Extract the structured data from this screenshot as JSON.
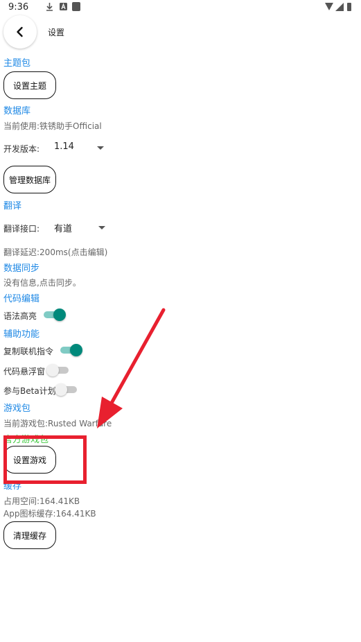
{
  "status_bar": {
    "time": "9:36",
    "icons": [
      "download-icon",
      "a-badge-icon",
      "notification-square-icon",
      "wifi-icon",
      "signal-icon",
      "battery-icon"
    ]
  },
  "header": {
    "back_icon": "chevron-left-icon",
    "title": "设置"
  },
  "theme": {
    "section": "主题包",
    "set_theme_button": "设置主题"
  },
  "database": {
    "section": "数据库",
    "current": "当前使用:铁锈助手Official",
    "dev_version_label": "开发版本:",
    "dev_version_value": "1.14",
    "manage_button": "管理数据库"
  },
  "translation": {
    "section": "翻译",
    "api_label": "翻译接口:",
    "api_value": "有道",
    "delay": "翻译延迟:200ms(点击编辑)"
  },
  "sync": {
    "section": "数据同步",
    "info": "没有信息,点击同步。"
  },
  "code_edit": {
    "section": "代码编辑",
    "syntax_highlight": {
      "label": "语法高亮",
      "on": true
    }
  },
  "assist": {
    "section": "辅助功能",
    "copy_online_cmd": {
      "label": "复制联机指令",
      "on": true
    },
    "code_float_window": {
      "label": "代码悬浮窗",
      "on": false
    },
    "beta_program": {
      "label": "参与Beta计划",
      "on": false
    }
  },
  "game_pack": {
    "section": "游戏包",
    "current": "当前游戏包:Rusted Warfare",
    "official_section": "官方游戏包",
    "set_game_button": "设置游戏"
  },
  "cache": {
    "section": "缓存",
    "used_space": "占用空间:164.41KB",
    "app_icon_cache": "App图标缓存:164.41KB",
    "clear_button": "清理缓存"
  },
  "annotation": {
    "color": "#e8202f"
  },
  "colors": {
    "accent_blue": "#1e88e5",
    "accent_green": "#43c943",
    "switch_on": "#00897b"
  }
}
